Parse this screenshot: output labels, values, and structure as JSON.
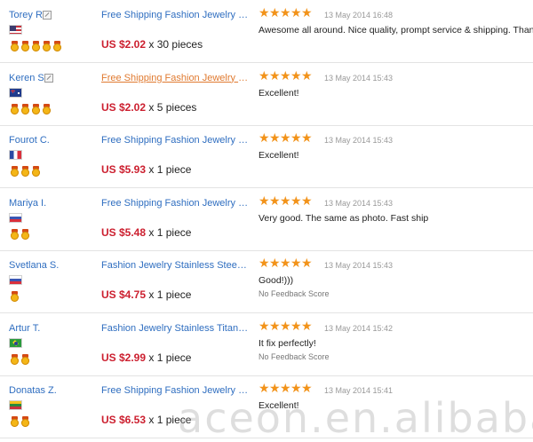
{
  "feedback": [
    {
      "buyer": "Torey R.",
      "has_note_icon": true,
      "country": "us",
      "medals": 5,
      "product": "Free Shipping Fashion Jewelry Half ...",
      "product_visited": false,
      "price": "US $2.02",
      "quantity": "x 30 pieces",
      "stars": 5,
      "date": "13 May 2014 16:48",
      "comment": "Awesome all around. Nice quality, prompt service & shipping. Thank you.",
      "no_feedback_score": ""
    },
    {
      "buyer": "Keren S.",
      "has_note_icon": true,
      "country": "au",
      "medals": 4,
      "product": "Free Shipping Fashion Jewelry Micke...",
      "product_visited": true,
      "price": "US $2.02",
      "quantity": "x 5 pieces",
      "stars": 5,
      "date": "13 May 2014 15:43",
      "comment": "Excellent!",
      "no_feedback_score": ""
    },
    {
      "buyer": "Fourot C.",
      "has_note_icon": false,
      "country": "fr",
      "medals": 3,
      "product": "Free Shipping Fashion Jewelry Stain...",
      "product_visited": false,
      "price": "US $5.93",
      "quantity": "x 1 piece",
      "stars": 5,
      "date": "13 May 2014 15:43",
      "comment": "Excellent!",
      "no_feedback_score": ""
    },
    {
      "buyer": "Mariya I.",
      "has_note_icon": false,
      "country": "ru",
      "medals": 2,
      "product": "Free Shipping Fashion Jewelry Puzzl...",
      "product_visited": false,
      "price": "US $5.48",
      "quantity": "x 1 piece",
      "stars": 5,
      "date": "13 May 2014 15:43",
      "comment": "Very good. The same as photo. Fast ship",
      "no_feedback_score": ""
    },
    {
      "buyer": "Svetlana S.",
      "has_note_icon": false,
      "country": "ru",
      "medals": 1,
      "product": "Fashion Jewelry Stainless Steel Rin...",
      "product_visited": false,
      "price": "US $4.75",
      "quantity": "x 1 piece",
      "stars": 5,
      "date": "13 May 2014 15:43",
      "comment": "Good!)))",
      "no_feedback_score": "No Feedback Score"
    },
    {
      "buyer": "Artur T.",
      "has_note_icon": false,
      "country": "br",
      "medals": 2,
      "product": "Fashion Jewelry Stainless Titanium ...",
      "product_visited": false,
      "price": "US $2.99",
      "quantity": "x 1 piece",
      "stars": 5,
      "date": "13 May 2014 15:42",
      "comment": "It fix perfectly!",
      "no_feedback_score": "No Feedback Score"
    },
    {
      "buyer": "Donatas Z.",
      "has_note_icon": false,
      "country": "lt",
      "medals": 2,
      "product": "Free Shipping Fashion Jewelry Silve...",
      "product_visited": false,
      "price": "US $6.53",
      "quantity": "x 1 piece",
      "stars": 5,
      "date": "13 May 2014 15:41",
      "comment": "Excellent!",
      "no_feedback_score": ""
    }
  ],
  "watermark": "aceon.en.alibaba.com",
  "colors": {
    "link": "#2f6ec0",
    "visited_link": "#e07a30",
    "price": "#cc1f2f",
    "star": "#f2931a",
    "date": "#999999",
    "row_divider": "#e3e3e3"
  }
}
